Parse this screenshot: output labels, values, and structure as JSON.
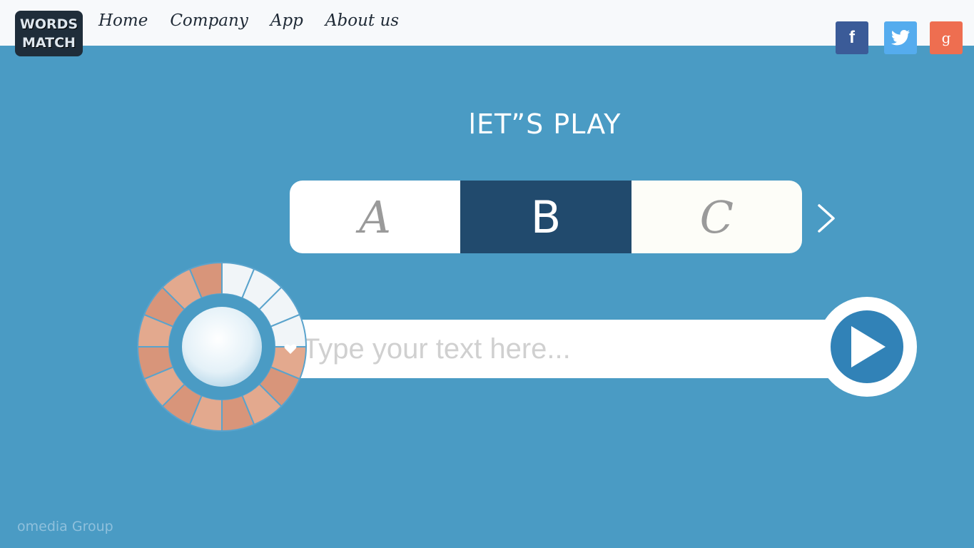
{
  "logo": {
    "line1": "WORDS",
    "line2": "MATCH"
  },
  "nav": {
    "home": "Home",
    "company": "Company",
    "app": "App",
    "about": "About us"
  },
  "social": {
    "facebook": "f",
    "twitter_icon": "twitter-bird-icon",
    "google": "g"
  },
  "title": "lET”S PLAY",
  "options": {
    "a": "A",
    "b": "B",
    "c": "C",
    "selected": "B"
  },
  "input": {
    "placeholder": "Type your text here...",
    "value": ""
  },
  "footer": {
    "brand": "omedia Group"
  },
  "colors": {
    "background": "#4a9bc4",
    "topbar": "#f7f9fb",
    "selected_option": "#214a6d",
    "play_button": "#3182b7",
    "facebook": "#3b5b98",
    "twitter": "#55acee",
    "google": "#ee6e50"
  }
}
